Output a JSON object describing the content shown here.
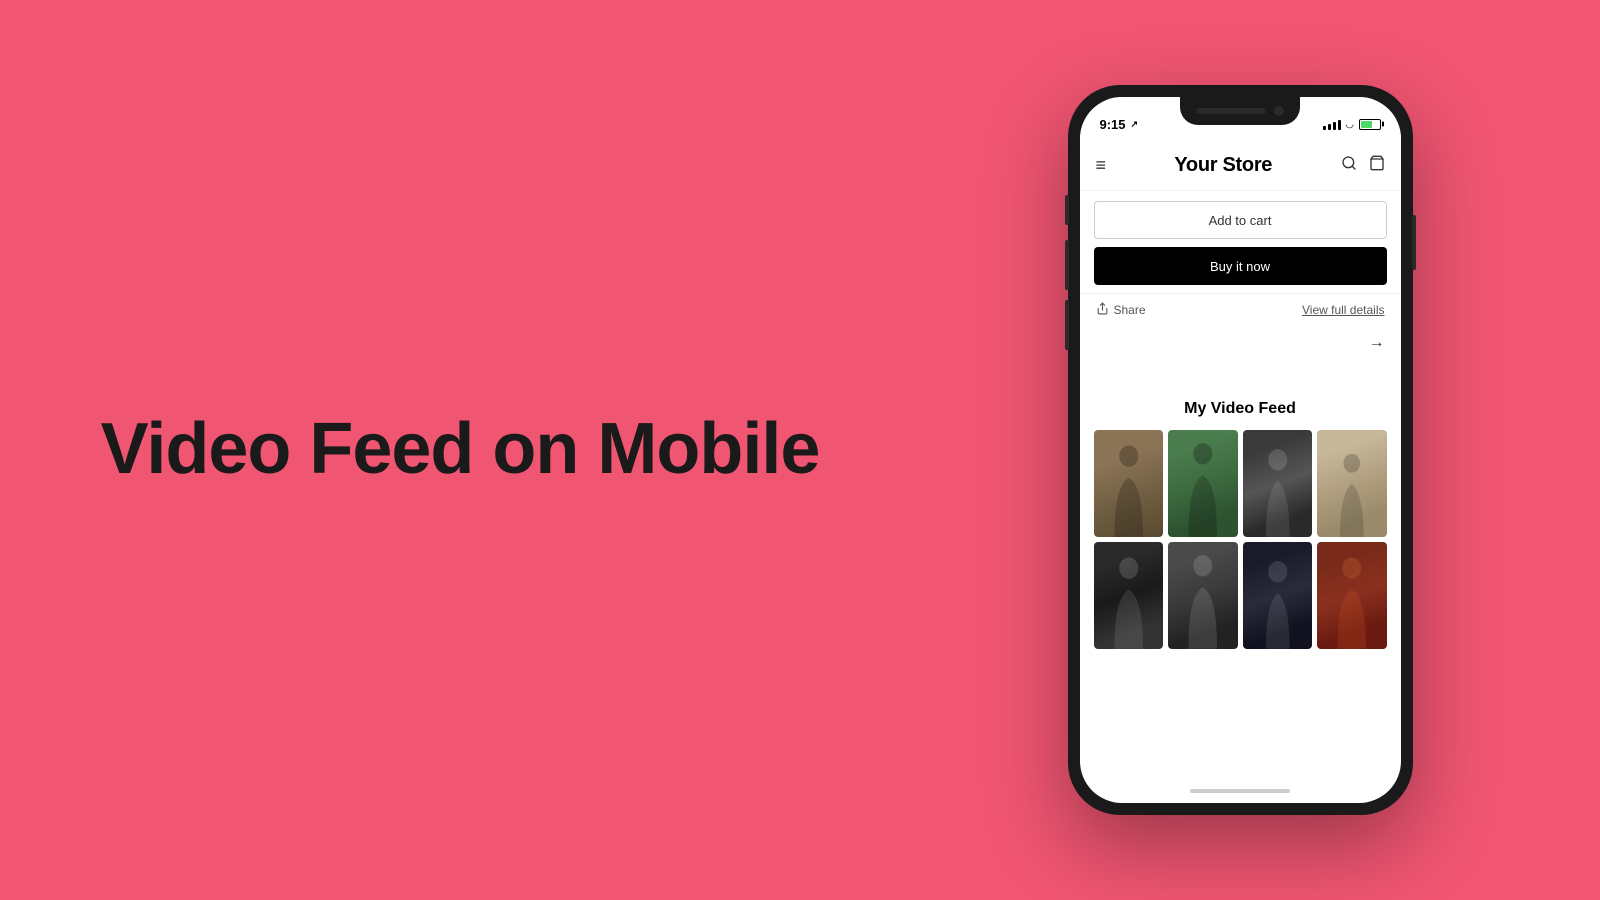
{
  "background_color": "#F05572",
  "left": {
    "headline": "Video Feed on Mobile"
  },
  "phone": {
    "status_bar": {
      "time": "9:15",
      "location_arrow": "⇗"
    },
    "nav": {
      "title": "Your Store",
      "menu_icon": "≡",
      "search_icon": "🔍",
      "cart_icon": "🛍"
    },
    "buttons": {
      "add_to_cart": "Add to cart",
      "buy_now": "Buy it now"
    },
    "share_row": {
      "share_label": "Share",
      "view_details": "View full details"
    },
    "video_feed": {
      "title": "My Video Feed",
      "thumbnails": [
        {
          "id": 1,
          "class": "thumb-1"
        },
        {
          "id": 2,
          "class": "thumb-2"
        },
        {
          "id": 3,
          "class": "thumb-3"
        },
        {
          "id": 4,
          "class": "thumb-4"
        },
        {
          "id": 5,
          "class": "thumb-5"
        },
        {
          "id": 6,
          "class": "thumb-6"
        },
        {
          "id": 7,
          "class": "thumb-7"
        },
        {
          "id": 8,
          "class": "thumb-8"
        }
      ]
    }
  }
}
